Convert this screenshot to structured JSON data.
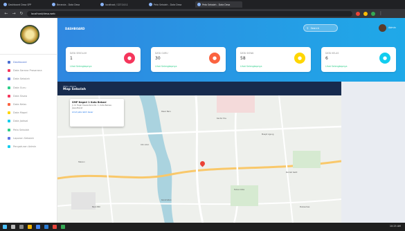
{
  "browser": {
    "tabs": [
      {
        "label": "Dashboard Desa SPP"
      },
      {
        "label": "Beranda - Data Desa"
      },
      {
        "label": "localhost / 127.0.0.1"
      },
      {
        "label": "Peta Sekolah - Data Desa"
      },
      {
        "label": "Peta Sekolah - Data Desa",
        "active": true
      }
    ],
    "url": "localhost/desa-web"
  },
  "sidebar": {
    "items": [
      {
        "label": "Dashboard",
        "color": "#4a6fd1",
        "active": true
      },
      {
        "label": "Data Sarana Prasarana",
        "color": "#f5365c"
      },
      {
        "label": "Data Sekolah",
        "color": "#5e72e4"
      },
      {
        "label": "Data Guru",
        "color": "#2dce89"
      },
      {
        "label": "Data Siswa",
        "color": "#f5365c"
      },
      {
        "label": "Data Kelas",
        "color": "#fb6340"
      },
      {
        "label": "Data Mapel",
        "color": "#ffd600"
      },
      {
        "label": "Data Jadwal",
        "color": "#11cdef"
      },
      {
        "label": "Peta Sekolah",
        "color": "#2dce89"
      },
      {
        "label": "Laporan Sekolah",
        "color": "#5e72e4"
      },
      {
        "label": "Pengaturan Admin",
        "color": "#11cdef"
      }
    ]
  },
  "header": {
    "title": "DASHBOARD",
    "search_placeholder": "Search",
    "user_name": "Admin"
  },
  "cards": [
    {
      "title": "DATA SEKOLAH",
      "value": "1",
      "link": "Lihat Selengkapnya",
      "color": "#f5365c",
      "icon": "chart-icon"
    },
    {
      "title": "DATA GURU",
      "value": "30",
      "link": "Lihat Selengkapnya",
      "color": "#fb6340",
      "icon": "users-icon"
    },
    {
      "title": "DATA SISWA",
      "value": "58",
      "link": "Lihat Selengkapnya",
      "color": "#ffd600",
      "icon": "student-icon"
    },
    {
      "title": "DATA KELAS",
      "value": "6",
      "link": "Lihat Selengkapnya",
      "color": "#11cdef",
      "icon": "class-icon"
    }
  ],
  "map_section": {
    "subtitle": "PETA LOKASI",
    "title": "Map Sekolah",
    "info_title": "SMP Negeri 1 Kota Bekasi",
    "info_address": "Jl. Ki Hajar Dewantara No. 1, Kota Bekasi, Jawa Barat",
    "info_link": "Lihat peta lebih besar",
    "labels": [
      "Pasar Baru",
      "Kantor Pos",
      "Masjid Agung",
      "Alun-alun",
      "Stasiun",
      "Rumah Sakit",
      "Kecamatan",
      "Taman Kota",
      "Bank BRI",
      "Puskesmas"
    ]
  },
  "taskbar": {
    "time": "10:25 AM"
  }
}
